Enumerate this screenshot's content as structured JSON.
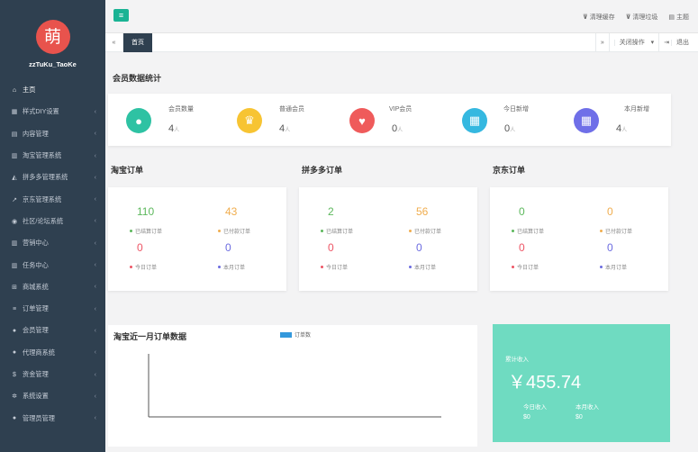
{
  "sidebar": {
    "avatar_char": "萌",
    "username": "zzTuKu_TaoKe",
    "items": [
      {
        "label": "主页",
        "icon": "home-icon",
        "glyph": "⌂"
      },
      {
        "label": "样式DIY设置",
        "icon": "grid-icon",
        "glyph": "▦"
      },
      {
        "label": "内容管理",
        "icon": "file-icon",
        "glyph": "▤"
      },
      {
        "label": "淘宝管理系统",
        "icon": "bar-chart-icon",
        "glyph": "▥"
      },
      {
        "label": "拼多多管理系统",
        "icon": "area-chart-icon",
        "glyph": "◭"
      },
      {
        "label": "京东管理系统",
        "icon": "line-chart-icon",
        "glyph": "↗"
      },
      {
        "label": "社区/论坛系统",
        "icon": "users-icon",
        "glyph": "◉"
      },
      {
        "label": "营销中心",
        "icon": "chart-icon",
        "glyph": "▥"
      },
      {
        "label": "任务中心",
        "icon": "task-chart-icon",
        "glyph": "▥"
      },
      {
        "label": "商城系统",
        "icon": "cart-icon",
        "glyph": "⊞"
      },
      {
        "label": "订单管理",
        "icon": "list-icon",
        "glyph": "≡"
      },
      {
        "label": "会员管理",
        "icon": "user-icon",
        "glyph": "●"
      },
      {
        "label": "代理商系统",
        "icon": "agent-icon",
        "glyph": "●"
      },
      {
        "label": "资金管理",
        "icon": "dollar-icon",
        "glyph": "$"
      },
      {
        "label": "系统设置",
        "icon": "gear-icon",
        "glyph": "✲"
      },
      {
        "label": "管理员管理",
        "icon": "admin-icon",
        "glyph": "●"
      }
    ]
  },
  "topbar": {
    "clear_cache": "清理缓存",
    "clear_trash": "清理垃圾",
    "theme": "主题"
  },
  "tabs": {
    "home": "首页",
    "close_ops": "关闭操作",
    "logout": "退出"
  },
  "stats_title": "会员数据统计",
  "stats": [
    {
      "label": "会员数量",
      "value": "4",
      "unit": "人",
      "color": "#2ec2a3"
    },
    {
      "label": "普通会员",
      "value": "4",
      "unit": "人",
      "color": "#f7c433"
    },
    {
      "label": "VIP会员",
      "value": "0",
      "unit": "人",
      "color": "#ef5b5b"
    },
    {
      "label": "今日新增",
      "value": "0",
      "unit": "人",
      "color": "#35b8e0"
    },
    {
      "label": "本月新增",
      "value": "4",
      "unit": "人",
      "color": "#6f6fe8"
    }
  ],
  "orders": [
    {
      "title": "淘宝订单",
      "settled": "110",
      "paid": "43",
      "today": "0",
      "month": "0"
    },
    {
      "title": "拼多多订单",
      "settled": "2",
      "paid": "56",
      "today": "0",
      "month": "0"
    },
    {
      "title": "京东订单",
      "settled": "0",
      "paid": "0",
      "today": "0",
      "month": "0"
    }
  ],
  "order_labels": {
    "settled": "已结算订单",
    "paid": "已付款订单",
    "today": "今日订单",
    "month": "本月订单"
  },
  "chart_data": {
    "type": "bar",
    "title": "淘宝近一月订单数据",
    "series": [
      {
        "name": "订单数",
        "values": []
      }
    ],
    "categories": [],
    "legend": "top"
  },
  "income": {
    "label": "累计收入",
    "value": "￥455.74",
    "today_label": "今日收入",
    "today_value": "$0",
    "month_label": "本月收入",
    "month_value": "$0"
  }
}
